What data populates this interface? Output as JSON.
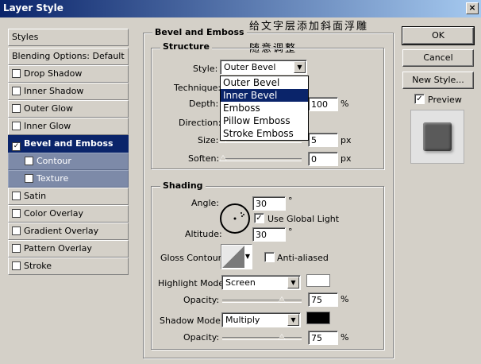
{
  "window": {
    "title": "Layer Style",
    "close": "×"
  },
  "overlay_text": {
    "line1": "给文字层添加斜面浮雕",
    "line2": "随意调整"
  },
  "left_panel": {
    "items": [
      {
        "label": "Styles",
        "type": "header"
      },
      {
        "label": "Blending Options: Default",
        "type": "header"
      },
      {
        "label": "Drop Shadow",
        "checked": false
      },
      {
        "label": "Inner Shadow",
        "checked": false
      },
      {
        "label": "Outer Glow",
        "checked": false
      },
      {
        "label": "Inner Glow",
        "checked": false
      },
      {
        "label": "Bevel and Emboss",
        "checked": true,
        "selected": true
      },
      {
        "label": "Contour",
        "checked": false,
        "sub": true
      },
      {
        "label": "Texture",
        "checked": false,
        "sub": true
      },
      {
        "label": "Satin",
        "checked": false
      },
      {
        "label": "Color Overlay",
        "checked": false
      },
      {
        "label": "Gradient Overlay",
        "checked": false
      },
      {
        "label": "Pattern Overlay",
        "checked": false
      },
      {
        "label": "Stroke",
        "checked": false
      }
    ]
  },
  "section_title": "Bevel and Emboss",
  "structure": {
    "title": "Structure",
    "style_label": "Style:",
    "style_value": "Outer Bevel",
    "style_options": [
      "Outer Bevel",
      "Inner Bevel",
      "Emboss",
      "Pillow Emboss",
      "Stroke Emboss"
    ],
    "highlighted_option": "Inner Bevel",
    "technique_label": "Technique:",
    "depth_label": "Depth:",
    "depth_value": "100",
    "depth_unit": "%",
    "direction_label": "Direction:",
    "size_label": "Size:",
    "size_value": "5",
    "size_unit": "px",
    "soften_label": "Soften:",
    "soften_value": "0",
    "soften_unit": "px"
  },
  "shading": {
    "title": "Shading",
    "angle_label": "Angle:",
    "angle_value": "30",
    "degree": "°",
    "use_global_light": "Use Global Light",
    "use_global_light_checked": true,
    "altitude_label": "Altitude:",
    "altitude_value": "30",
    "gloss_contour_label": "Gloss Contour:",
    "anti_aliased": "Anti-aliased",
    "anti_aliased_checked": false,
    "highlight_mode_label": "Highlight Mode:",
    "highlight_mode_value": "Screen",
    "highlight_color": "#ffffff",
    "highlight_opacity_label": "Opacity:",
    "highlight_opacity_value": "75",
    "shadow_mode_label": "Shadow Mode:",
    "shadow_mode_value": "Multiply",
    "shadow_color": "#000000",
    "shadow_opacity_label": "Opacity:",
    "shadow_opacity_value": "75",
    "percent": "%"
  },
  "buttons": {
    "ok": "OK",
    "cancel": "Cancel",
    "new_style": "New Style...",
    "preview": "Preview",
    "preview_checked": true
  }
}
